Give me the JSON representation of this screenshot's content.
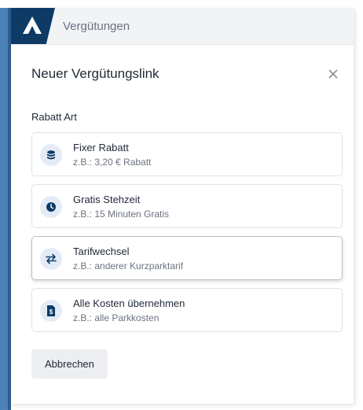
{
  "app": {
    "breadcrumb": "Vergütungen"
  },
  "dialog": {
    "title": "Neuer Vergütungslink",
    "section_label": "Rabatt Art",
    "cancel_label": "Abbrechen"
  },
  "options": [
    {
      "title": "Fixer Rabatt",
      "subtitle": "z.B.:  3,20 € Rabatt",
      "icon": "coins-icon",
      "selected": false
    },
    {
      "title": "Gratis Stehzeit",
      "subtitle": "z.B.:  15 Minuten Gratis",
      "icon": "clock-icon",
      "selected": false
    },
    {
      "title": "Tarifwechsel",
      "subtitle": "z.B.:  anderer Kurzparktarif",
      "icon": "swap-arrows-icon",
      "selected": true
    },
    {
      "title": "Alle Kosten übernehmen",
      "subtitle": "z.B.:  alle Parkkosten",
      "icon": "receipt-icon",
      "selected": false
    }
  ],
  "colors": {
    "brand": "#0d3b66",
    "icon_bg": "#e3ecf6",
    "frame": "#4d82b8"
  }
}
